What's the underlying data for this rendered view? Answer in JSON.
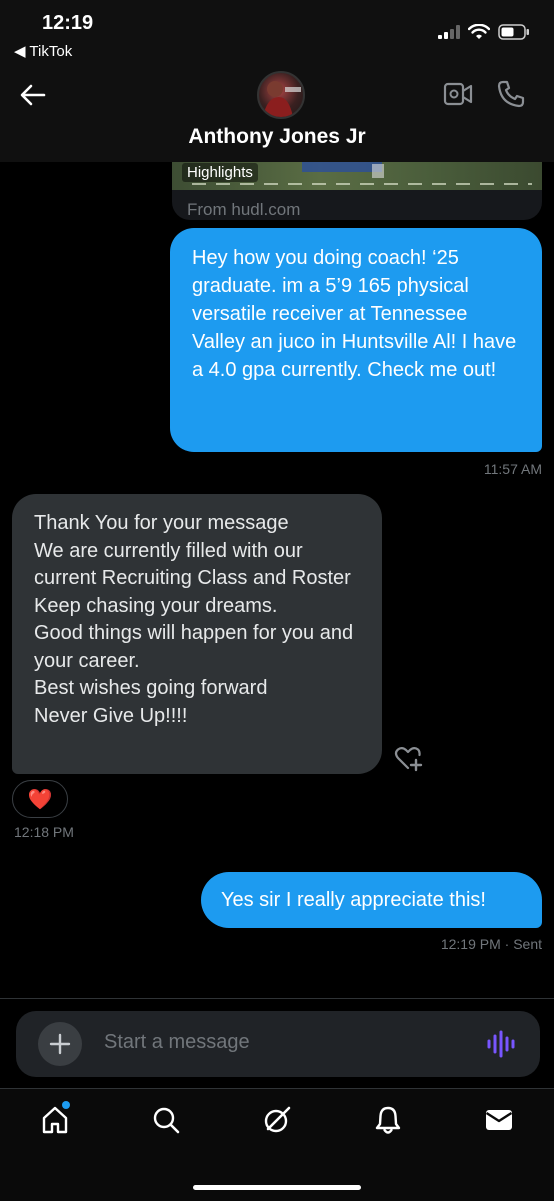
{
  "status_bar": {
    "time": "12:19",
    "back_app": "◀ TikTok"
  },
  "header": {
    "contact_name": "Anthony Jones Jr"
  },
  "link_card": {
    "tag": "Highlights",
    "source": "From hudl.com"
  },
  "messages": [
    {
      "direction": "outgoing",
      "text": "Hey how you doing coach! ‘25 graduate. im a 5’9 165 physical versatile receiver at Tennessee Valley an juco in Huntsville Al! I have a 4.0 gpa currently. Check me out!",
      "timestamp": "11:57 AM"
    },
    {
      "direction": "incoming",
      "lines": [
        "Thank You for your message",
        "We are currently filled with our current Recruiting Class and Roster",
        "Keep chasing your dreams.",
        "Good things will happen for you and your career.",
        "Best wishes going forward",
        "Never Give Up!!!!"
      ],
      "reaction": "❤️",
      "timestamp": "12:18 PM"
    },
    {
      "direction": "outgoing",
      "text": "Yes sir I really appreciate this!",
      "timestamp": "12:19 PM · Sent"
    }
  ],
  "composer": {
    "placeholder": "Start a message"
  },
  "nav": {
    "items": [
      "home-icon",
      "search-icon",
      "grok-icon",
      "notifications-icon",
      "messages-icon"
    ]
  },
  "colors": {
    "accent": "#1d9bf0",
    "incoming_bubble": "#2f3336",
    "background": "#000000",
    "voice": "#7856ff"
  }
}
